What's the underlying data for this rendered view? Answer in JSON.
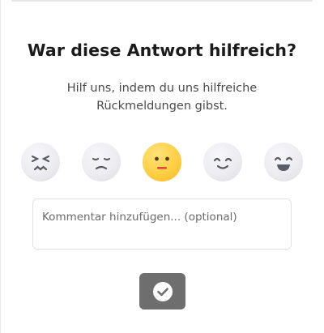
{
  "title": "War diese Antwort hilfreich?",
  "subtitle": "Hilf uns, indem du uns hilfreiche Rückmeldungen gibst.",
  "ratings": {
    "options": [
      {
        "icon": "very-dissatisfied-face-icon",
        "selected": false
      },
      {
        "icon": "dissatisfied-face-icon",
        "selected": false
      },
      {
        "icon": "neutral-face-icon",
        "selected": true
      },
      {
        "icon": "satisfied-face-icon",
        "selected": false
      },
      {
        "icon": "very-satisfied-face-icon",
        "selected": false
      }
    ]
  },
  "comment": {
    "value": "",
    "placeholder": "Kommentar hinzufügen... (optional)"
  },
  "submit": {
    "icon": "checkmark-icon"
  },
  "colors": {
    "selected_face": "#ffcf45",
    "unselected_face": "#ececf1",
    "submit_button": "#6e6e6e",
    "title_text": "#1b1b1b"
  }
}
